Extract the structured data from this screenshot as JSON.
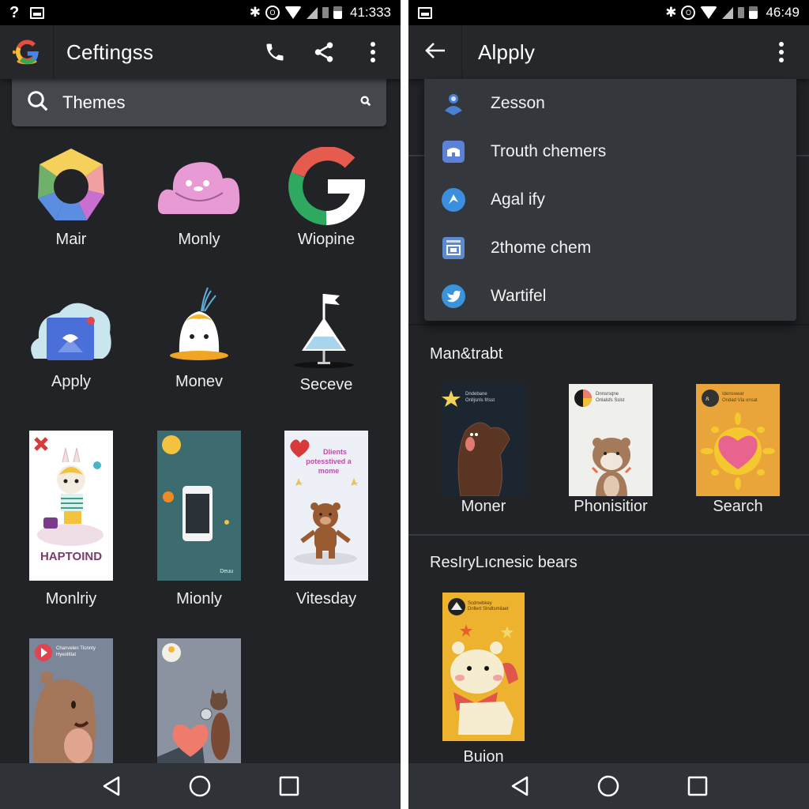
{
  "left": {
    "status": {
      "time": "41:333",
      "left_icons": [
        "help-icon",
        "image-icon"
      ],
      "right_icons": [
        "bluetooth-icon",
        "sync-icon",
        "wifi-icon",
        "signal-icon",
        "sim-icon",
        "battery-icon"
      ]
    },
    "appbar": {
      "title": "Ceftingss",
      "logo": "google-g-icon",
      "actions": [
        "phone-icon",
        "share-icon",
        "more-vert-icon"
      ]
    },
    "search": {
      "label": "Themes",
      "left_icon": "search-icon",
      "right_icon": "small-search-icon"
    },
    "apps": [
      {
        "label": "Mair",
        "icon": "color-wheel-icon"
      },
      {
        "label": "Monly",
        "icon": "pink-cloud-icon"
      },
      {
        "label": "Wiopine",
        "icon": "google-g-icon"
      },
      {
        "label": "Apply",
        "icon": "cloud-folder-icon"
      },
      {
        "label": "Monev",
        "icon": "ghost-icon"
      },
      {
        "label": "Seceve",
        "icon": "flag-flask-icon"
      }
    ],
    "themes": [
      {
        "label": "Monlriy",
        "caption": "HAPTOIND"
      },
      {
        "label": "Mionly",
        "caption": "Deuu"
      },
      {
        "label": "Vitesday",
        "caption": "Dlients potesstived a mome"
      },
      {
        "label": "",
        "caption": "Chanvelen Tlonnty Hyeolttlat"
      },
      {
        "label": "",
        "caption": ""
      }
    ],
    "navbar": [
      "back-icon",
      "home-icon",
      "recents-icon"
    ]
  },
  "right": {
    "status": {
      "time": "46:49",
      "left_icons": [
        "image-icon"
      ],
      "right_icons": [
        "bluetooth-icon",
        "sync-icon",
        "wifi-icon",
        "signal-icon",
        "sim-icon",
        "battery-icon"
      ]
    },
    "appbar": {
      "title": "Alpply",
      "actions": [
        "back-arrow-icon",
        "more-vert-icon"
      ]
    },
    "menu": [
      {
        "label": "Zesson",
        "icon": "person-icon",
        "color": "#4a7fd4"
      },
      {
        "label": "Trouth chemers",
        "icon": "store-icon",
        "color": "#5b82d6"
      },
      {
        "label": "Agal ify",
        "icon": "send-icon",
        "color": "#3b8fde"
      },
      {
        "label": "2thome chem",
        "icon": "calendar-icon",
        "color": "#5b8ad0"
      },
      {
        "label": "Wartifel",
        "icon": "twitter-icon",
        "color": "#3b93dc"
      }
    ],
    "sections": [
      {
        "title": "Man&trabt",
        "items": [
          {
            "label": "Moner",
            "caption": "Dndebane Onlljsnls frlsst",
            "bg": "#1c2630"
          },
          {
            "label": "Phonisitior",
            "caption": "Dnnsrsqne Onlalsfs Sslst",
            "bg": "#efefec"
          },
          {
            "label": "Search",
            "caption": "Idenswear Ondad Vla onsat",
            "bg": "#e9a53a"
          }
        ]
      },
      {
        "title": "ResIryLıcnesic bears",
        "items": [
          {
            "label": "Buion",
            "caption": "Scdnwbkey Dnllert Slndtsmilaet",
            "bg": "#edb32f"
          }
        ]
      }
    ],
    "navbar": [
      "back-icon",
      "home-icon",
      "recents-icon"
    ]
  }
}
